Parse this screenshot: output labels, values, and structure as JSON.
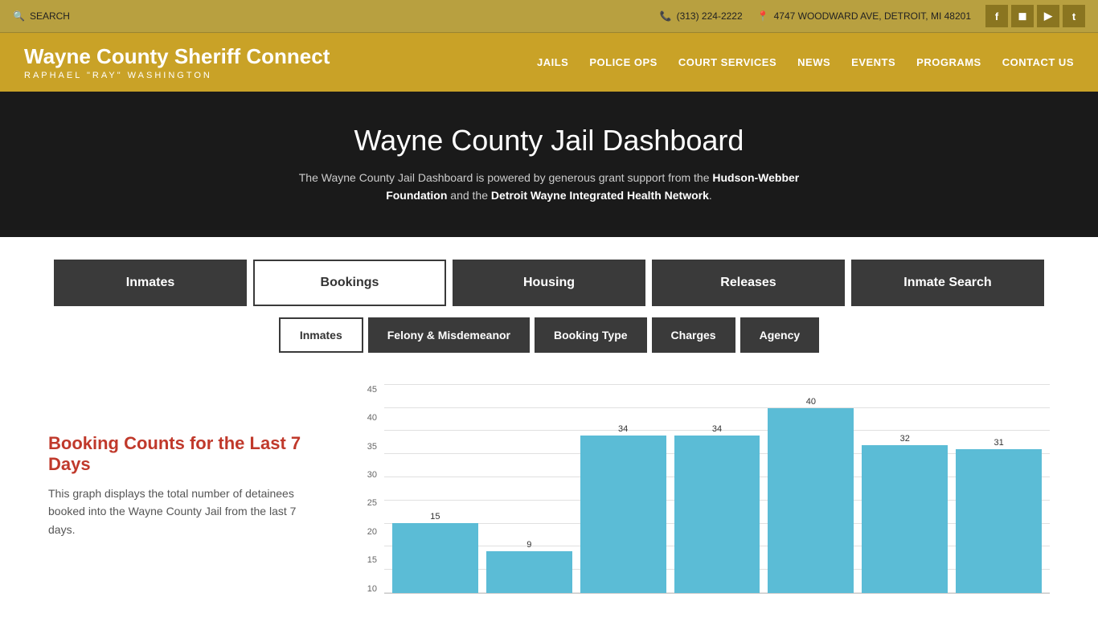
{
  "topbar": {
    "search_label": "SEARCH",
    "phone": "(313) 224-2222",
    "address": "4747 WOODWARD AVE, DETROIT, MI 48201",
    "social": [
      "f",
      "■",
      "▶",
      "t"
    ]
  },
  "header": {
    "brand_name": "Wayne County Sheriff Connect",
    "brand_subtitle": "RAPHAEL  \"RAY\"  WASHINGTON",
    "nav": [
      "JAILS",
      "POLICE OPS",
      "COURT SERVICES",
      "NEWS",
      "EVENTS",
      "PROGRAMS",
      "CONTACT US"
    ]
  },
  "hero": {
    "title": "Wayne County Jail Dashboard",
    "description": "The Wayne County Jail Dashboard is powered by generous grant support from the ",
    "foundation": "Hudson-Webber Foundation",
    "and_text": " and the ",
    "network": "Detroit Wayne Integrated Health Network",
    "period": "."
  },
  "nav_row1": [
    {
      "label": "Inmates",
      "style": "dark"
    },
    {
      "label": "Bookings",
      "style": "outline"
    },
    {
      "label": "Housing",
      "style": "dark"
    },
    {
      "label": "Releases",
      "style": "dark"
    },
    {
      "label": "Inmate Search",
      "style": "dark"
    }
  ],
  "nav_row2": [
    {
      "label": "Inmates",
      "style": "outline"
    },
    {
      "label": "Felony & Misdemeanor",
      "style": "dark"
    },
    {
      "label": "Booking Type",
      "style": "dark"
    },
    {
      "label": "Charges",
      "style": "dark"
    },
    {
      "label": "Agency",
      "style": "dark"
    }
  ],
  "chart": {
    "title": "Booking Counts for the Last 7 Days",
    "description": "This graph displays the total number of detainees booked into the Wayne County Jail from the last 7 days.",
    "y_labels": [
      "45",
      "40",
      "35",
      "30",
      "25",
      "20",
      "15",
      "10"
    ],
    "bars": [
      {
        "value": 15,
        "label": "15"
      },
      {
        "value": 9,
        "label": "9"
      },
      {
        "value": 34,
        "label": "34"
      },
      {
        "value": 34,
        "label": "34"
      },
      {
        "value": 40,
        "label": "40"
      },
      {
        "value": 32,
        "label": "32"
      },
      {
        "value": 31,
        "label": "31"
      }
    ],
    "max": 45
  }
}
